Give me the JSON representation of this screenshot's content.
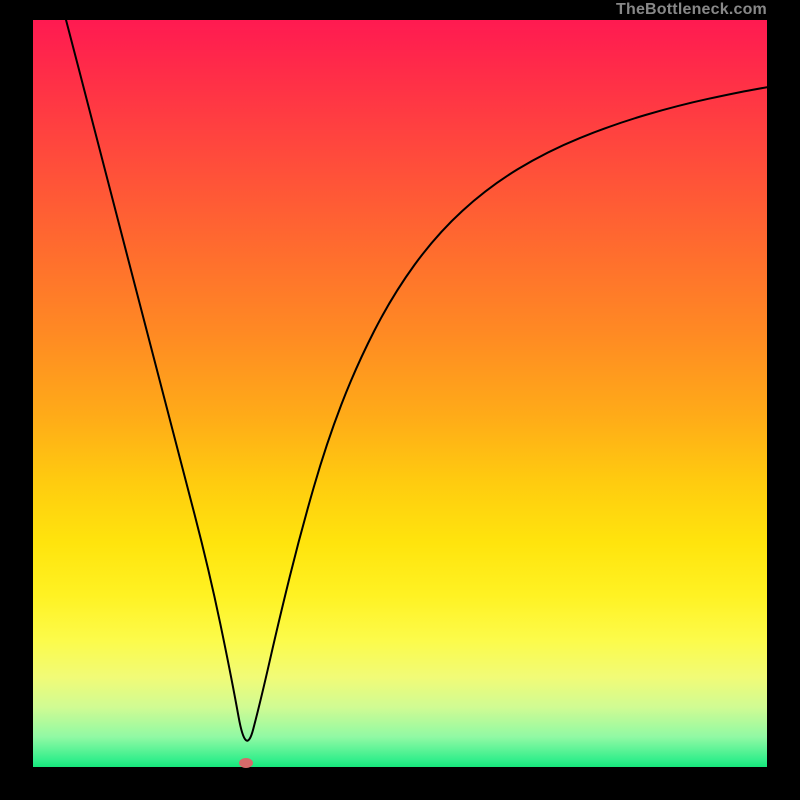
{
  "watermark": "TheBottleneck.com",
  "colors": {
    "curve_stroke": "#000000",
    "marker_fill": "#d66a6a"
  },
  "chart_data": {
    "type": "line",
    "title": "",
    "xlabel": "",
    "ylabel": "",
    "xlim": [
      0,
      1
    ],
    "ylim": [
      0,
      1
    ],
    "annotations": [
      {
        "name": "minimum-marker",
        "x": 0.29,
        "y": 0.005
      }
    ],
    "series": [
      {
        "name": "bottleneck-curve",
        "x": [
          0.045,
          0.08,
          0.12,
          0.16,
          0.2,
          0.24,
          0.27,
          0.29,
          0.31,
          0.335,
          0.365,
          0.4,
          0.44,
          0.49,
          0.55,
          0.62,
          0.7,
          0.79,
          0.88,
          0.96,
          1.0
        ],
        "values": [
          1.0,
          0.868,
          0.716,
          0.565,
          0.414,
          0.263,
          0.122,
          0.013,
          0.088,
          0.196,
          0.315,
          0.434,
          0.536,
          0.632,
          0.713,
          0.776,
          0.824,
          0.86,
          0.886,
          0.903,
          0.91
        ]
      }
    ]
  }
}
